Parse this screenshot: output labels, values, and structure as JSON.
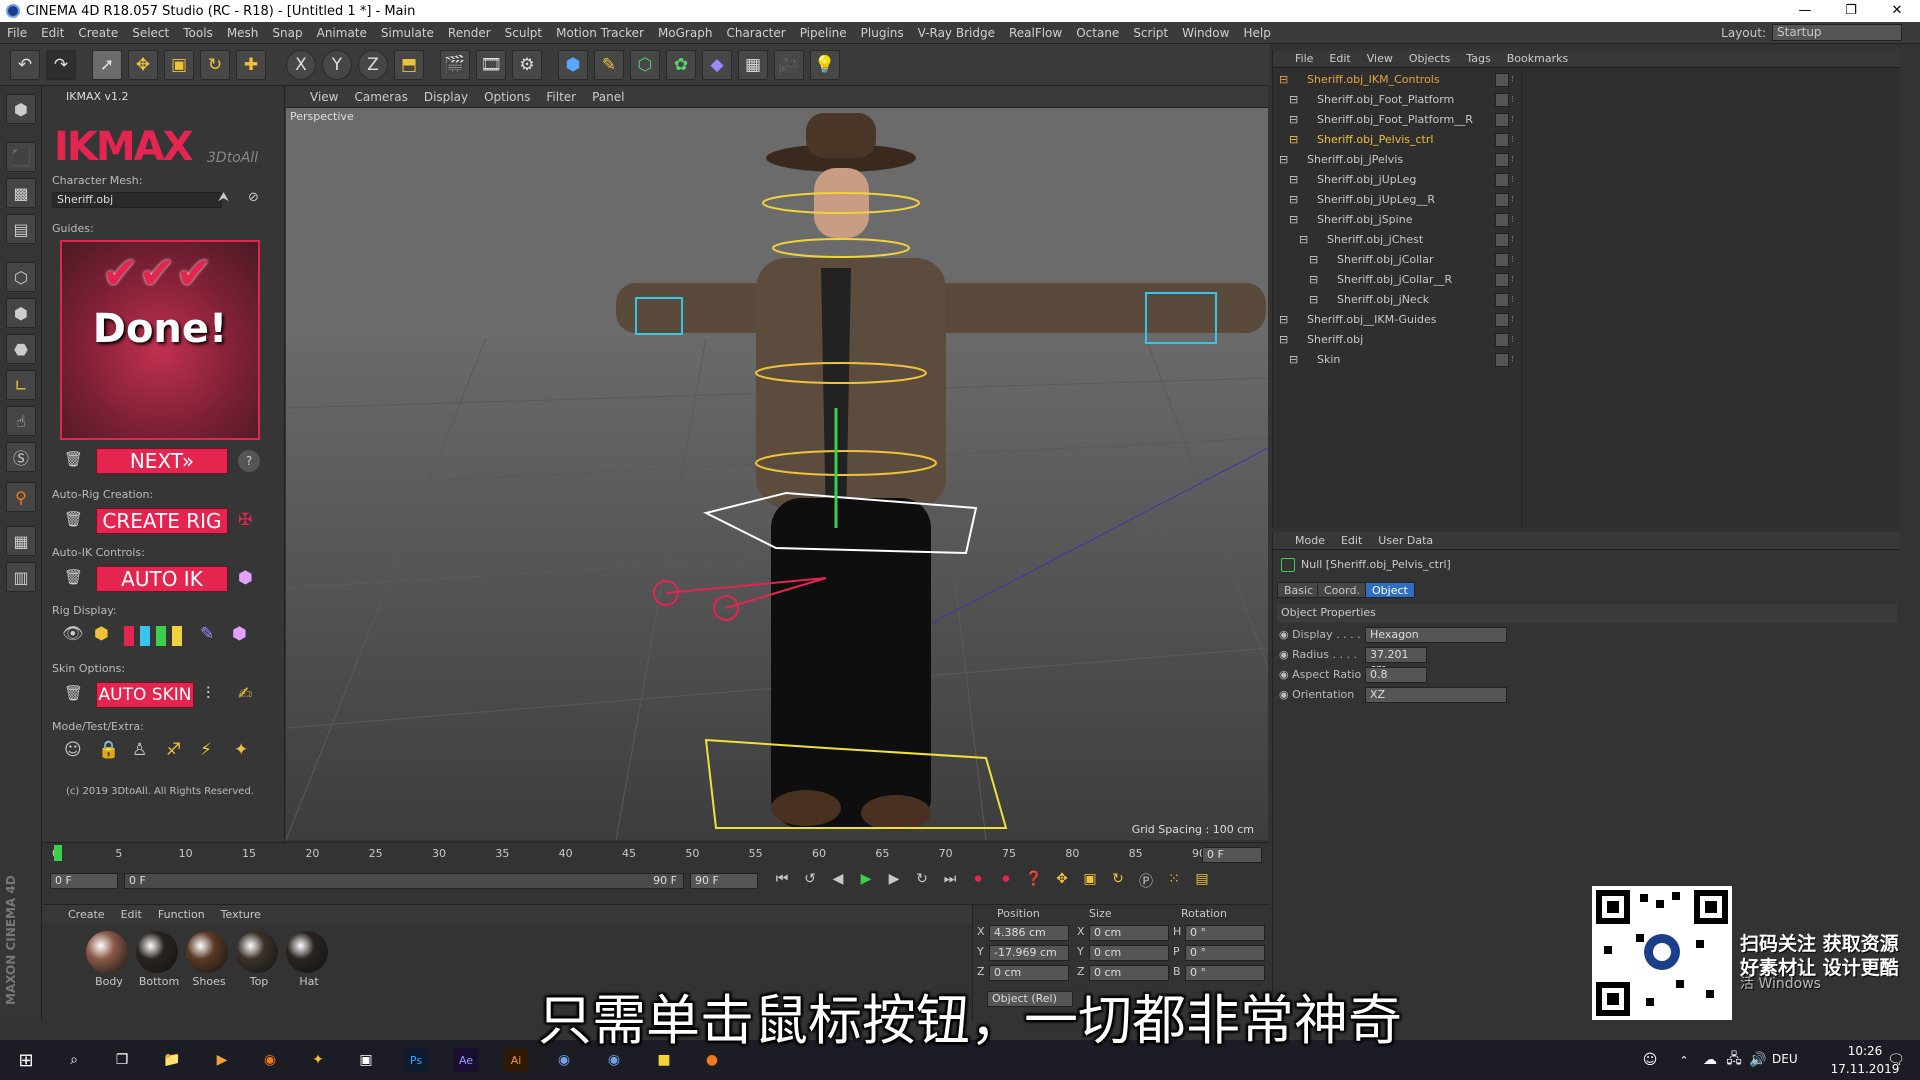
{
  "title_bar": {
    "text": "CINEMA 4D R18.057 Studio (RC - R18) - [Untitled 1 *] - Main",
    "buttons": [
      "—",
      "❐",
      "✕"
    ]
  },
  "menu": [
    "File",
    "Edit",
    "Create",
    "Select",
    "Tools",
    "Mesh",
    "Snap",
    "Animate",
    "Simulate",
    "Render",
    "Sculpt",
    "Motion Tracker",
    "MoGraph",
    "Character",
    "Pipeline",
    "Plugins",
    "V-Ray Bridge",
    "RealFlow",
    "Octane",
    "Script",
    "Window",
    "Help"
  ],
  "layout": {
    "label": "Layout:",
    "value": "Startup"
  },
  "toolbar": {
    "x": "X",
    "y": "Y",
    "z": "Z"
  },
  "ikmax": {
    "panel_title": "IKMAX v1.2",
    "logo": "IKMAX",
    "logo_sub": "3DtoAll",
    "char_mesh_label": "Character Mesh:",
    "char_mesh_value": "Sheriff.obj",
    "guides_label": "Guides:",
    "done": "Done!",
    "next": "NEXT»",
    "help": "?",
    "autorig_label": "Auto-Rig Creation:",
    "create_rig": "CREATE RIG",
    "autoik_label": "Auto-IK Controls:",
    "auto_ik": "AUTO IK",
    "rigdisplay_label": "Rig Display:",
    "skin_label": "Skin Options:",
    "auto_skin": "AUTO SKIN",
    "mode_label": "Mode/Test/Extra:",
    "copyright": "(c) 2019 3DtoAll. All Rights Reserved."
  },
  "viewport": {
    "menu": [
      "View",
      "Cameras",
      "Display",
      "Options",
      "Filter",
      "Panel"
    ],
    "label": "Perspective",
    "grid": "Grid Spacing : 100 cm"
  },
  "object_manager": {
    "menu": [
      "File",
      "Edit",
      "View",
      "Objects",
      "Tags",
      "Bookmarks"
    ],
    "rows": [
      {
        "name": "Sheriff.obj_IKM_Controls",
        "indent": 0,
        "color": "#e7a33a"
      },
      {
        "name": "Sheriff.obj_Foot_Platform",
        "indent": 1,
        "color": "#c8c8c8"
      },
      {
        "name": "Sheriff.obj_Foot_Platform__R",
        "indent": 1,
        "color": "#c8c8c8"
      },
      {
        "name": "Sheriff.obj_Pelvis_ctrl",
        "indent": 1,
        "color": "#f0c23a"
      },
      {
        "name": "Sheriff.obj_jPelvis",
        "indent": 0,
        "color": "#c8c8c8"
      },
      {
        "name": "Sheriff.obj_jUpLeg",
        "indent": 1,
        "color": "#c8c8c8"
      },
      {
        "name": "Sheriff.obj_jUpLeg__R",
        "indent": 1,
        "color": "#c8c8c8"
      },
      {
        "name": "Sheriff.obj_jSpine",
        "indent": 1,
        "color": "#c8c8c8"
      },
      {
        "name": "Sheriff.obj_jChest",
        "indent": 2,
        "color": "#c8c8c8"
      },
      {
        "name": "Sheriff.obj_jCollar",
        "indent": 3,
        "color": "#c8c8c8"
      },
      {
        "name": "Sheriff.obj_jCollar__R",
        "indent": 3,
        "color": "#c8c8c8"
      },
      {
        "name": "Sheriff.obj_jNeck",
        "indent": 3,
        "color": "#c8c8c8"
      },
      {
        "name": "Sheriff.obj__IKM-Guides",
        "indent": 0,
        "color": "#c8c8c8"
      },
      {
        "name": "Sheriff.obj",
        "indent": 0,
        "color": "#c8c8c8"
      },
      {
        "name": "Skin",
        "indent": 1,
        "color": "#c8c8c8"
      }
    ]
  },
  "attributes": {
    "menu": [
      "Mode",
      "Edit",
      "User Data"
    ],
    "header": "Null [Sheriff.obj_Pelvis_ctrl]",
    "tabs": [
      "Basic",
      "Coord.",
      "Object"
    ],
    "section": "Object Properties",
    "props": [
      {
        "label": "Display . . . .",
        "value": "Hexagon"
      },
      {
        "label": "Radius . . . .",
        "value": "37.201 cm"
      },
      {
        "label": "Aspect Ratio",
        "value": "0.8"
      },
      {
        "label": "Orientation",
        "value": "XZ"
      }
    ]
  },
  "timeline": {
    "ticks": [
      "0",
      "5",
      "10",
      "15",
      "20",
      "25",
      "30",
      "35",
      "40",
      "45",
      "50",
      "55",
      "60",
      "65",
      "70",
      "75",
      "80",
      "85",
      "90"
    ],
    "end_frame": "0 F",
    "start": "0 F",
    "range_start": "0 F",
    "range_end": "90 F",
    "max": "90 F"
  },
  "materials": {
    "menu": [
      "Create",
      "Edit",
      "Function",
      "Texture"
    ],
    "items": [
      "Body",
      "Bottom",
      "Shoes",
      "Top",
      "Hat"
    ]
  },
  "coords": {
    "headers": [
      "Position",
      "Size",
      "Rotation"
    ],
    "rows": [
      {
        "a": "X",
        "pos": "4.386 cm",
        "b": "X",
        "size": "0 cm",
        "c": "H",
        "rot": "0 °"
      },
      {
        "a": "Y",
        "pos": "-17.969 cm",
        "b": "Y",
        "size": "0 cm",
        "c": "P",
        "rot": "0 °"
      },
      {
        "a": "Z",
        "pos": "0 cm",
        "b": "Z",
        "size": "0 cm",
        "c": "B",
        "rot": "0 °"
      }
    ],
    "mode": "Object (Rel)"
  },
  "maxon": "MAXON CINEMA 4D",
  "subtitle": "只需单击鼠标按钮，一切都非常神奇",
  "promo": {
    "line1": "扫码关注 获取资源",
    "line2": "好素材让 设计更酷",
    "watermark": "活 Windows"
  },
  "taskbar": {
    "lang": "DEU",
    "time": "10:26",
    "date": "17.11.2019"
  }
}
